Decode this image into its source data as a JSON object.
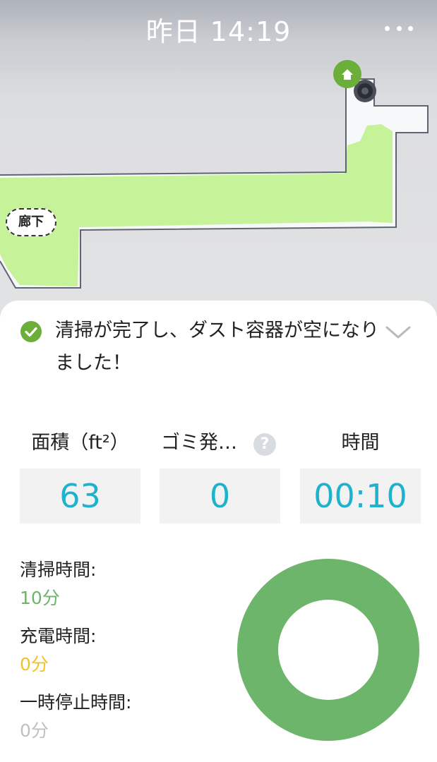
{
  "header": {
    "title": "昨日 14:19"
  },
  "map": {
    "room_label": "廊下",
    "colors": {
      "cleaned": "#c6f29a",
      "wall": "#5e6570",
      "pin": "#6bae3a"
    }
  },
  "status": {
    "message": "清掃が完了し、ダスト容器が空になりました！",
    "icon": "check-circle-icon",
    "expand_icon": "chevron-down-icon"
  },
  "stats": {
    "area": {
      "label": "面積（ft²）",
      "value": "63"
    },
    "debris": {
      "label": "ゴミ発…",
      "value": "0",
      "help_icon": "?"
    },
    "duration": {
      "label": "時間",
      "value": "00:10"
    },
    "value_color": "#1fb2cf"
  },
  "time_breakdown": [
    {
      "label": "清掃時間:",
      "value": "10分",
      "color": "#6cb56a"
    },
    {
      "label": "充電時間:",
      "value": "0分",
      "color": "#f2c22b"
    },
    {
      "label": "一時停止時間:",
      "value": "0分",
      "color": "#c0c0c0"
    }
  ],
  "chart_data": {
    "type": "pie",
    "categories": [
      "清掃時間",
      "充電時間",
      "一時停止時間"
    ],
    "values": [
      10,
      0,
      0
    ],
    "colors": [
      "#6cb56a",
      "#f2c22b",
      "#c0c0c0"
    ]
  }
}
